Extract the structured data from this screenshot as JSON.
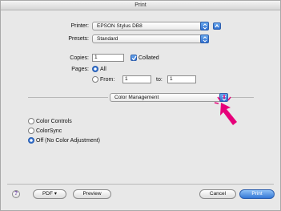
{
  "window": {
    "title": "Print"
  },
  "printer": {
    "label": "Printer:",
    "value": "EPSON Stylus DB8"
  },
  "presets": {
    "label": "Presets:",
    "value": "Standard"
  },
  "copies": {
    "label": "Copies:",
    "value": "1",
    "collated_label": "Collated",
    "collated_checked": true
  },
  "pages": {
    "label": "Pages:",
    "all_label": "All",
    "from_label": "From:",
    "from_value": "1",
    "to_label": "to:",
    "to_value": "1",
    "selected": "All"
  },
  "panel": {
    "value": "Color Management"
  },
  "color_options": [
    {
      "label": "Color Controls",
      "selected": false
    },
    {
      "label": "ColorSync",
      "selected": false
    },
    {
      "label": "Off (No Color Adjustment)",
      "selected": true
    }
  ],
  "footer": {
    "help_glyph": "?",
    "pdf_label": "PDF ▾",
    "preview_label": "Preview",
    "cancel_label": "Cancel",
    "print_label": "Print"
  },
  "colors": {
    "accent": "#2f6fd0",
    "pointer": "#e6007a"
  },
  "icons": [
    "chevron-updown-icon",
    "expand-icon",
    "help-icon",
    "pointer-arrow-icon"
  ]
}
